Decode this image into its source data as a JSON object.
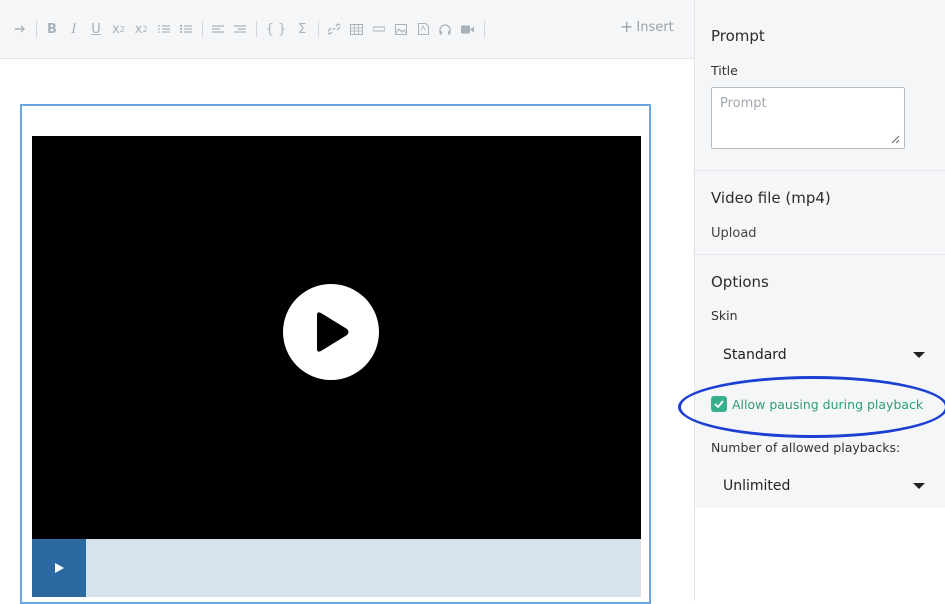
{
  "toolbar": {
    "insert_label": "Insert",
    "buttons": [
      "indent-arrow",
      "bold",
      "italic",
      "underline",
      "subscript",
      "superscript",
      "ordered-list",
      "unordered-list",
      "align-left",
      "align-right",
      "braces",
      "sigma",
      "link",
      "table",
      "minus",
      "image",
      "pdf",
      "headphones",
      "video-camera"
    ]
  },
  "video": {
    "big_play_icon": "play-icon",
    "control_play_icon": "play-small-icon"
  },
  "panel": {
    "prompt_title": "Prompt",
    "title_label": "Title",
    "title_placeholder": "Prompt",
    "video_title": "Video file (mp4)",
    "upload_label": "Upload",
    "options_title": "Options",
    "skin_label": "Skin",
    "skin_value": "Standard",
    "allow_pausing_label": "Allow pausing during playback",
    "allow_pausing_checked": true,
    "allowed_playbacks_label": "Number of allowed playbacks:",
    "allowed_playbacks_value": "Unlimited"
  },
  "colors": {
    "accent_green": "#36b08a",
    "highlight_blue": "#1b3fd1",
    "video_border": "#6ba7df",
    "control_blue": "#2b6aa0"
  }
}
